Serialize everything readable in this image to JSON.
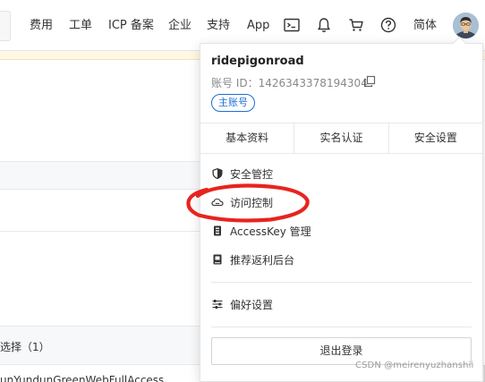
{
  "topnav": {
    "items": [
      "费用",
      "工单",
      "ICP 备案",
      "企业",
      "支持",
      "App"
    ],
    "icons": [
      "terminal-icon",
      "bell-icon",
      "cart-icon",
      "help-icon"
    ],
    "language": "简体"
  },
  "background": {
    "selected_label": "选择（1）",
    "policy_text": "unYundunGreenWebFullAccess"
  },
  "panel": {
    "username": "ridepigonroad",
    "account_id": "账号 ID：1426343378194304",
    "account_type": "主账号",
    "tabs": [
      "基本资料",
      "实名认证",
      "安全设置"
    ],
    "menu": [
      {
        "label": "安全管控",
        "icon": "shield-icon"
      },
      {
        "label": "访问控制",
        "icon": "cloud-key-icon"
      },
      {
        "label": "AccessKey 管理",
        "icon": "key-card-icon"
      },
      {
        "label": "推荐返利后台",
        "icon": "book-icon"
      }
    ],
    "preferences": {
      "label": "偏好设置",
      "icon": "sliders-icon"
    },
    "logout": "退出登录"
  },
  "annotation": {
    "color": "#e8231f"
  },
  "watermark": "CSDN @meirenyuzhanshii",
  "colors": {
    "accent": "#1d6ed3",
    "notice": "#fff8e5"
  }
}
